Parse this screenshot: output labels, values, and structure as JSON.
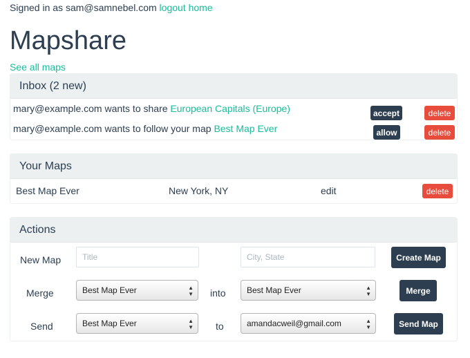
{
  "header": {
    "signed_in_text": "Signed in as sam@samnebel.com",
    "logout_label": "logout",
    "home_label": "home"
  },
  "page": {
    "title": "Mapshare",
    "see_all_label": "See all maps"
  },
  "inbox": {
    "heading": "Inbox (2 new)",
    "items": [
      {
        "text": "mary@example.com wants to share",
        "link": "European Capitals (Europe)",
        "action": "accept",
        "delete": "delete"
      },
      {
        "text": "mary@example.com wants to follow your map",
        "link": "Best Map Ever",
        "action": "allow",
        "delete": "delete"
      }
    ]
  },
  "your_maps": {
    "heading": "Your Maps",
    "rows": [
      {
        "name": "Best Map Ever",
        "location": "New York, NY",
        "edit": "edit",
        "delete": "delete"
      }
    ]
  },
  "actions": {
    "heading": "Actions",
    "new_map": {
      "label": "New Map",
      "title_placeholder": "Title",
      "city_placeholder": "City, State",
      "button": "Create Map"
    },
    "merge": {
      "label": "Merge",
      "from_value": "Best Map Ever",
      "connector": "into",
      "to_value": "Best Map Ever",
      "button": "Merge"
    },
    "send": {
      "label": "Send",
      "map_value": "Best Map Ever",
      "connector": "to",
      "recipient_value": "amandacweil@gmail.com",
      "button": "Send Map"
    }
  },
  "colors": {
    "link": "#18bc9c",
    "primary": "#2c3e50",
    "danger": "#e74c3c",
    "panel_heading": "#ecf0f1"
  },
  "icons": {
    "select_arrows": "up-down-arrows-icon"
  }
}
